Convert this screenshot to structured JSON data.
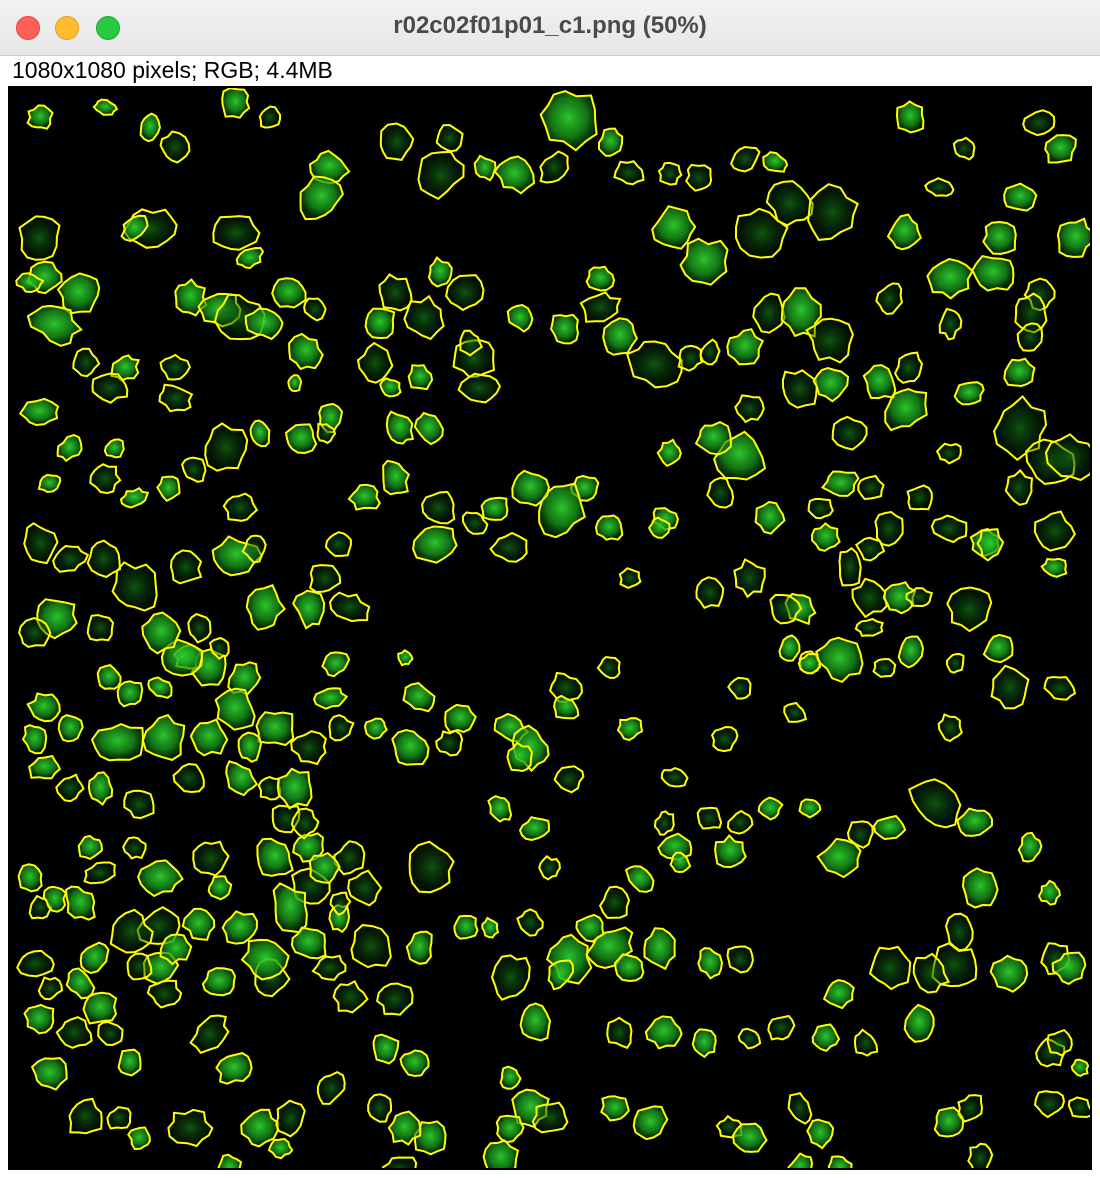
{
  "window": {
    "title": "r02c02f01p01_c1.png (50%)"
  },
  "image_info": "1080x1080 pixels; RGB; 4.4MB",
  "overlay": {
    "outline_color": "#ffff00",
    "cell_color": "#1fa81f",
    "background_color": "#000000"
  }
}
